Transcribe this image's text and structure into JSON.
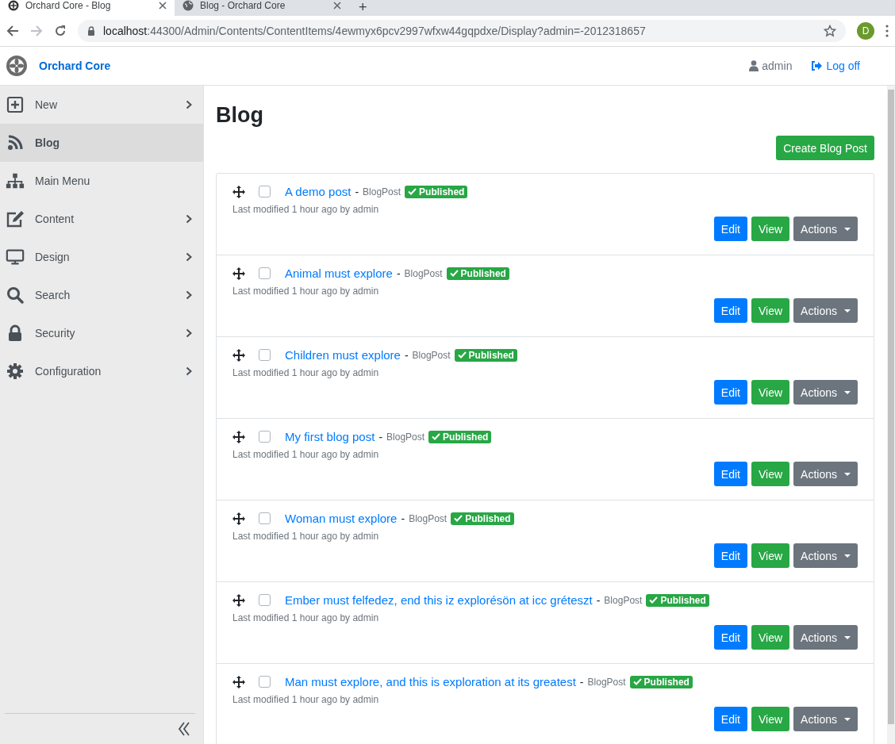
{
  "browser": {
    "tabs": [
      {
        "title": "Orchard Core - Blog",
        "selected": true
      },
      {
        "title": "Blog - Orchard Core",
        "selected": false
      }
    ],
    "new_tab": "+",
    "url_host": "localhost",
    "url_rest": ":44300/Admin/Contents/ContentItems/4ewmyx6pcv2997wfxw44gqpdxe/Display?admin=-2012318657",
    "profile_initial": "D"
  },
  "header": {
    "brand": "Orchard Core",
    "user": "admin",
    "logout": "Log off"
  },
  "sidebar": {
    "items": [
      {
        "label": "New",
        "kind": "plus",
        "selected": false,
        "has_submenu": true
      },
      {
        "label": "Blog",
        "kind": "rss",
        "selected": true,
        "has_submenu": false
      },
      {
        "label": "Main Menu",
        "kind": "sitemap",
        "selected": false,
        "has_submenu": false
      },
      {
        "label": "Content",
        "kind": "edit",
        "selected": false,
        "has_submenu": true
      },
      {
        "label": "Design",
        "kind": "monitor",
        "selected": false,
        "has_submenu": true
      },
      {
        "label": "Search",
        "kind": "search",
        "selected": false,
        "has_submenu": true
      },
      {
        "label": "Security",
        "kind": "lock",
        "selected": false,
        "has_submenu": true
      },
      {
        "label": "Configuration",
        "kind": "gear",
        "selected": false,
        "has_submenu": true
      }
    ]
  },
  "page": {
    "title": "Blog",
    "create_button": "Create Blog Post"
  },
  "posts": [
    {
      "title": "A demo post",
      "separator": "-",
      "type": "BlogPost",
      "status": "Published",
      "modified": "Last modified 1 hour ago by admin",
      "checked": false,
      "edit": "Edit",
      "view": "View",
      "actions": "Actions"
    },
    {
      "title": "Animal must explore",
      "separator": "-",
      "type": "BlogPost",
      "status": "Published",
      "modified": "Last modified 1 hour ago by admin",
      "checked": false,
      "edit": "Edit",
      "view": "View",
      "actions": "Actions"
    },
    {
      "title": "Children must explore",
      "separator": "-",
      "type": "BlogPost",
      "status": "Published",
      "modified": "Last modified 1 hour ago by admin",
      "checked": false,
      "edit": "Edit",
      "view": "View",
      "actions": "Actions"
    },
    {
      "title": "My first blog post",
      "separator": "-",
      "type": "BlogPost",
      "status": "Published",
      "modified": "Last modified 1 hour ago by admin",
      "checked": false,
      "edit": "Edit",
      "view": "View",
      "actions": "Actions"
    },
    {
      "title": "Woman must explore",
      "separator": "-",
      "type": "BlogPost",
      "status": "Published",
      "modified": "Last modified 1 hour ago by admin",
      "checked": false,
      "edit": "Edit",
      "view": "View",
      "actions": "Actions"
    },
    {
      "title": "Ember must felfedez, end this iz explorésön at icc gréteszt",
      "separator": "-",
      "type": "BlogPost",
      "status": "Published",
      "modified": "Last modified 1 hour ago by admin",
      "checked": false,
      "edit": "Edit",
      "view": "View",
      "actions": "Actions"
    },
    {
      "title": "Man must explore, and this is exploration at its greatest",
      "separator": "-",
      "type": "BlogPost",
      "status": "Published",
      "modified": "Last modified 1 hour ago by admin",
      "checked": false,
      "edit": "Edit",
      "view": "View",
      "actions": "Actions"
    }
  ]
}
